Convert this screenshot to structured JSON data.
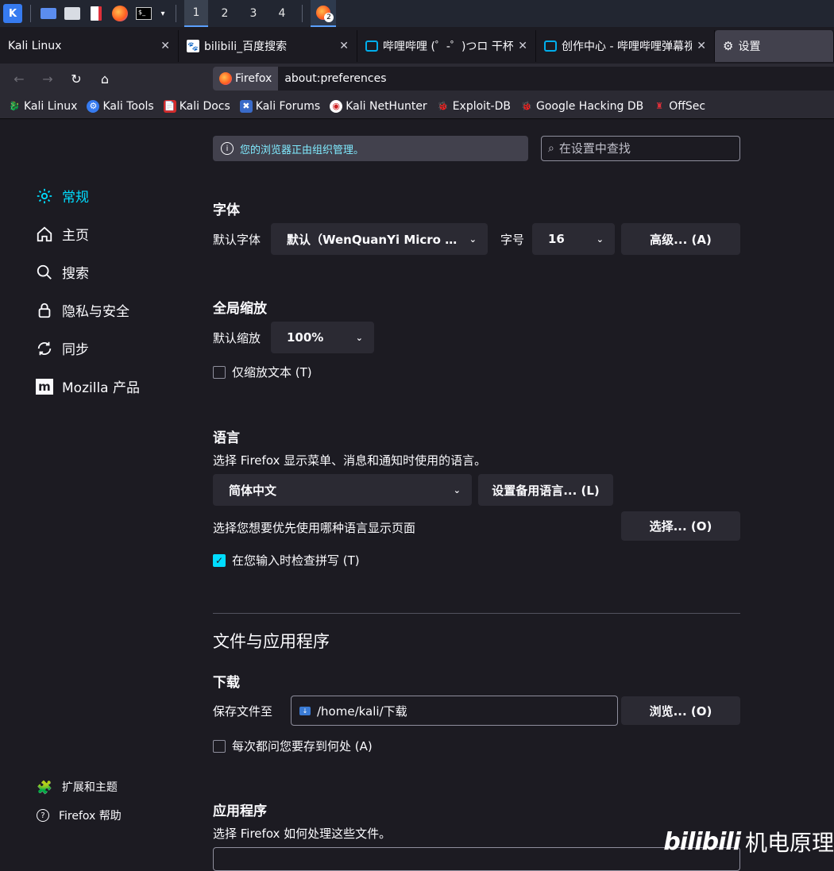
{
  "panel": {
    "workspaces": [
      "1",
      "2",
      "3",
      "4"
    ],
    "notify_count": "2"
  },
  "tabs": [
    {
      "label": "Kali Linux"
    },
    {
      "label": "bilibili_百度搜索"
    },
    {
      "label": "哔哩哔哩 (゜-゜)つロ 干杯"
    },
    {
      "label": "创作中心 - 哔哩哔哩弹幕视"
    },
    {
      "label": "设置"
    }
  ],
  "navbar": {
    "identity": "Firefox",
    "url": "about:preferences"
  },
  "bookmarks": [
    "Kali Linux",
    "Kali Tools",
    "Kali Docs",
    "Kali Forums",
    "Kali NetHunter",
    "Exploit-DB",
    "Google Hacking DB",
    "OffSec"
  ],
  "notice": "您的浏览器正由组织管理。",
  "search": {
    "placeholder": "在设置中查找"
  },
  "sidebar": {
    "items": [
      {
        "label": "常规"
      },
      {
        "label": "主页"
      },
      {
        "label": "搜索"
      },
      {
        "label": "隐私与安全"
      },
      {
        "label": "同步"
      },
      {
        "label": "Mozilla 产品"
      }
    ],
    "footer": [
      {
        "label": "扩展和主题"
      },
      {
        "label": "Firefox 帮助"
      }
    ]
  },
  "fonts": {
    "heading": "字体",
    "default_font_label": "默认字体",
    "default_font_value": "默认（WenQuanYi Micro Hei）",
    "size_label": "字号",
    "size_value": "16",
    "advanced_button": "高级... (A)"
  },
  "zoom": {
    "heading": "全局缩放",
    "default_zoom_label": "默认缩放",
    "default_zoom_value": "100%",
    "zoom_text_only": "仅缩放文本 (T)"
  },
  "language": {
    "heading": "语言",
    "description": "选择 Firefox 显示菜单、消息和通知时使用的语言。",
    "ui_language": "简体中文",
    "alt_language_button": "设置备用语言... (L)",
    "page_language_label": "选择您想要优先使用哪种语言显示页面",
    "choose_button": "选择... (O)",
    "spellcheck": "在您输入时检查拼写 (T)"
  },
  "files": {
    "section_title": "文件与应用程序",
    "downloads_heading": "下载",
    "save_to_label": "保存文件至",
    "save_path": "/home/kali/下载",
    "browse_button": "浏览... (O)",
    "always_ask": "每次都问您要存到何处 (A)",
    "apps_heading": "应用程序",
    "apps_description": "选择 Firefox 如何处理这些文件。"
  },
  "watermark": "机电原理",
  "colors": {
    "accent": "#00ddff",
    "bg": "#1c1b22",
    "button": "#2b2a33"
  }
}
